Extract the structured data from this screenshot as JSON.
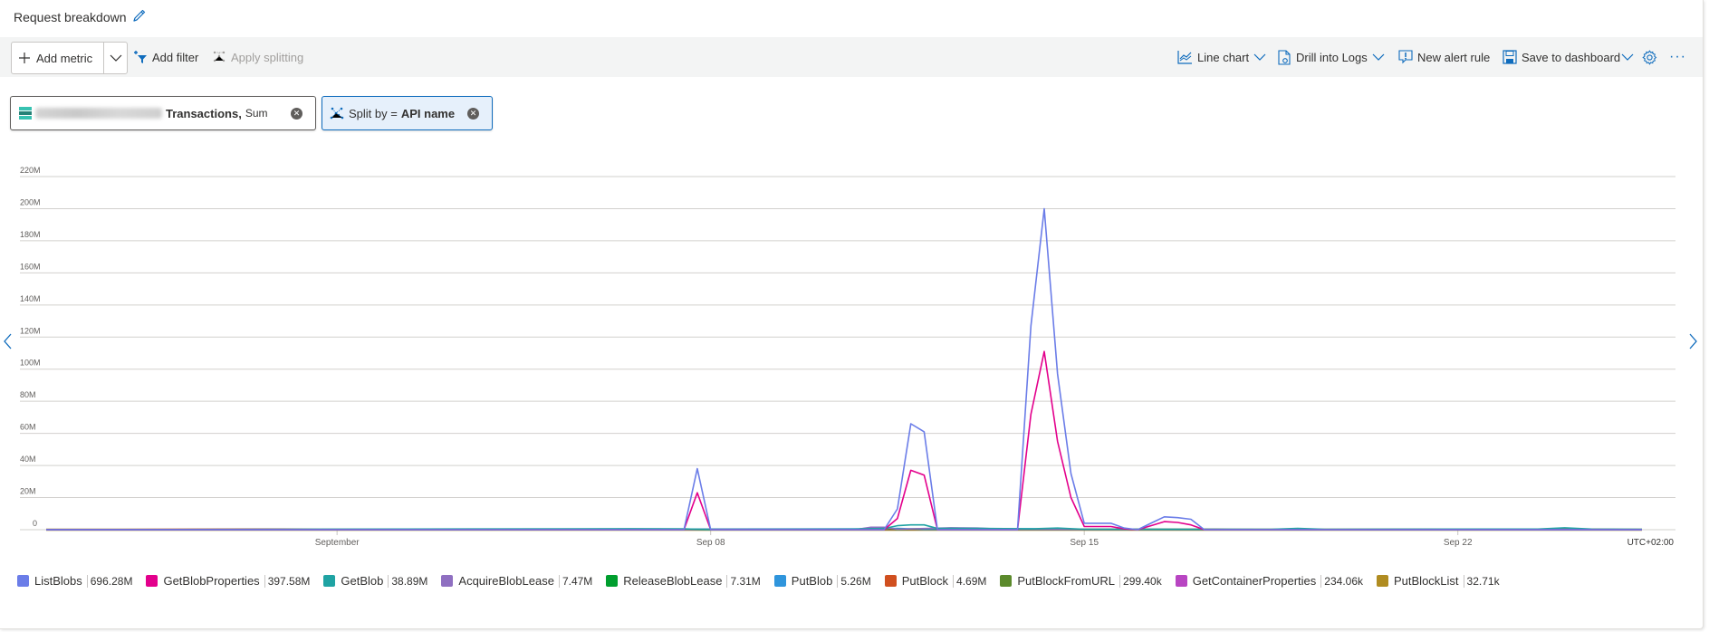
{
  "header": {
    "title": "Request breakdown",
    "edit_icon": "pencil-icon"
  },
  "toolbar": {
    "add_metric": "Add metric",
    "add_filter": "Add filter",
    "apply_splitting": "Apply splitting",
    "line_chart": "Line chart",
    "drill_into_logs": "Drill into Logs",
    "new_alert_rule": "New alert rule",
    "save_to_dashboard": "Save to dashboard",
    "settings_icon": "gear-icon",
    "more_icon": "ellipsis-icon",
    "more_label": "···"
  },
  "pills": {
    "metric": {
      "metric_name": "Transactions,",
      "aggregation": "Sum",
      "remove_glyph": "✕"
    },
    "split": {
      "prefix": "Split by =",
      "value": "API name",
      "remove_glyph": "✕"
    }
  },
  "chart_data": {
    "type": "line",
    "title": "Request breakdown",
    "xlabel": "",
    "ylabel": "",
    "timezone_label": "UTC+02:00",
    "ylim": [
      0,
      220000000
    ],
    "yticks": [
      0,
      20000000,
      40000000,
      60000000,
      80000000,
      100000000,
      120000000,
      140000000,
      160000000,
      180000000,
      200000000,
      220000000
    ],
    "ytick_labels": [
      "0",
      "20M",
      "40M",
      "60M",
      "80M",
      "100M",
      "120M",
      "140M",
      "160M",
      "180M",
      "200M",
      "220M"
    ],
    "x_unit": "days since Sep 1",
    "xlim": [
      -5.45,
      24.45
    ],
    "xticks": [
      {
        "x": 0,
        "label": "September"
      },
      {
        "x": 7,
        "label": "Sep 08"
      },
      {
        "x": 14,
        "label": "Sep 15"
      },
      {
        "x": 21,
        "label": "Sep 22"
      }
    ],
    "grid": true,
    "legend_position": "bottom",
    "series": [
      {
        "name": "ListBlobs",
        "total": "696.28M",
        "color": "#6b7de8",
        "points": [
          [
            -5.45,
            0
          ],
          [
            6.5,
            0
          ],
          [
            6.75,
            38
          ],
          [
            7.0,
            0
          ],
          [
            9.5,
            0
          ],
          [
            10.25,
            0
          ],
          [
            10.5,
            13
          ],
          [
            10.75,
            66
          ],
          [
            11.0,
            61
          ],
          [
            11.25,
            0
          ],
          [
            12.75,
            0
          ],
          [
            13.0,
            127
          ],
          [
            13.25,
            200
          ],
          [
            13.5,
            97
          ],
          [
            13.75,
            35
          ],
          [
            14.0,
            4
          ],
          [
            14.25,
            4
          ],
          [
            14.5,
            4
          ],
          [
            14.75,
            1
          ],
          [
            15.0,
            0
          ],
          [
            15.25,
            4
          ],
          [
            15.5,
            8
          ],
          [
            15.75,
            7.5
          ],
          [
            16.0,
            6.5
          ],
          [
            16.25,
            0
          ],
          [
            24.45,
            0
          ]
        ]
      },
      {
        "name": "GetBlobProperties",
        "total": "397.58M",
        "color": "#e3008c",
        "points": [
          [
            -5.45,
            0
          ],
          [
            6.5,
            0
          ],
          [
            6.75,
            23
          ],
          [
            7.0,
            0
          ],
          [
            10.25,
            0
          ],
          [
            10.5,
            7
          ],
          [
            10.75,
            37
          ],
          [
            11.0,
            34
          ],
          [
            11.25,
            0
          ],
          [
            12.75,
            0
          ],
          [
            13.0,
            72
          ],
          [
            13.25,
            111
          ],
          [
            13.5,
            55
          ],
          [
            13.75,
            20
          ],
          [
            14.0,
            2
          ],
          [
            14.25,
            2
          ],
          [
            14.5,
            2
          ],
          [
            14.75,
            0.5
          ],
          [
            15.0,
            0
          ],
          [
            15.25,
            2.5
          ],
          [
            15.5,
            5
          ],
          [
            15.75,
            4.5
          ],
          [
            16.0,
            3
          ],
          [
            16.25,
            0
          ],
          [
            24.45,
            0
          ]
        ]
      },
      {
        "name": "GetBlob",
        "total": "38.89M",
        "color": "#1fa3a3",
        "points": [
          [
            -5.45,
            0
          ],
          [
            5.5,
            0.6
          ],
          [
            6.5,
            0.5
          ],
          [
            7.0,
            0
          ],
          [
            9.5,
            0.3
          ],
          [
            10.25,
            0.8
          ],
          [
            10.5,
            2.5
          ],
          [
            10.75,
            3
          ],
          [
            11.0,
            3
          ],
          [
            11.25,
            0.8
          ],
          [
            12.0,
            0.8
          ],
          [
            13.0,
            0.5
          ],
          [
            13.5,
            1
          ],
          [
            14.0,
            0.3
          ],
          [
            17.5,
            0.2
          ],
          [
            18.0,
            0.8
          ],
          [
            18.5,
            0.3
          ],
          [
            22.5,
            0.4
          ],
          [
            23.0,
            1.2
          ],
          [
            23.5,
            0.4
          ],
          [
            24.45,
            0.3
          ]
        ]
      },
      {
        "name": "AcquireBlobLease",
        "total": "7.47M",
        "color": "#8f6fc1",
        "points": [
          [
            -5.45,
            0
          ],
          [
            9.75,
            0.2
          ],
          [
            10.0,
            1.5
          ],
          [
            10.25,
            1.5
          ],
          [
            10.5,
            0.3
          ],
          [
            11.5,
            1.2
          ],
          [
            12.0,
            1
          ],
          [
            12.5,
            0.2
          ],
          [
            24.45,
            0
          ]
        ]
      },
      {
        "name": "ReleaseBlobLease",
        "total": "7.31M",
        "color": "#009e2e",
        "points": [
          [
            -5.45,
            0
          ],
          [
            9.75,
            0.2
          ],
          [
            10.0,
            1.2
          ],
          [
            10.25,
            1.2
          ],
          [
            10.5,
            0.2
          ],
          [
            11.5,
            1
          ],
          [
            12.0,
            0.8
          ],
          [
            12.5,
            0.2
          ],
          [
            24.45,
            0
          ]
        ]
      },
      {
        "name": "PutBlob",
        "total": "5.26M",
        "color": "#2f95dc",
        "points": [
          [
            -5.45,
            0
          ],
          [
            10.0,
            0.5
          ],
          [
            10.5,
            0.8
          ],
          [
            11.0,
            0.2
          ],
          [
            13.0,
            0.6
          ],
          [
            13.5,
            0.2
          ],
          [
            24.45,
            0
          ]
        ]
      },
      {
        "name": "PutBlock",
        "total": "4.69M",
        "color": "#d04f1f",
        "points": [
          [
            -5.45,
            0
          ],
          [
            -1.5,
            0.4
          ],
          [
            -1.0,
            0.4
          ],
          [
            0,
            0
          ],
          [
            2.5,
            0.4
          ],
          [
            3.0,
            0.3
          ],
          [
            4.0,
            0
          ],
          [
            8.5,
            0.4
          ],
          [
            9.0,
            0.3
          ],
          [
            16.5,
            0.3
          ],
          [
            17.0,
            0
          ],
          [
            20.5,
            0.3
          ],
          [
            21.0,
            0
          ],
          [
            23.0,
            0.4
          ],
          [
            24.45,
            0
          ]
        ]
      },
      {
        "name": "PutBlockFromURL",
        "total": "299.40k",
        "color": "#5b8a2c",
        "points": [
          [
            -5.45,
            0
          ],
          [
            24.45,
            0
          ]
        ]
      },
      {
        "name": "GetContainerProperties",
        "total": "234.06k",
        "color": "#b845c2",
        "points": [
          [
            -5.45,
            0
          ],
          [
            24.45,
            0
          ]
        ]
      },
      {
        "name": "PutBlockList",
        "total": "32.71k",
        "color": "#b08c21",
        "points": [
          [
            -5.45,
            0
          ],
          [
            24.45,
            0
          ]
        ]
      }
    ]
  },
  "colors": {
    "accent": "#0f6cbd",
    "grid": "#d2d0ce",
    "toolbar_bg": "#f3f4f4"
  }
}
